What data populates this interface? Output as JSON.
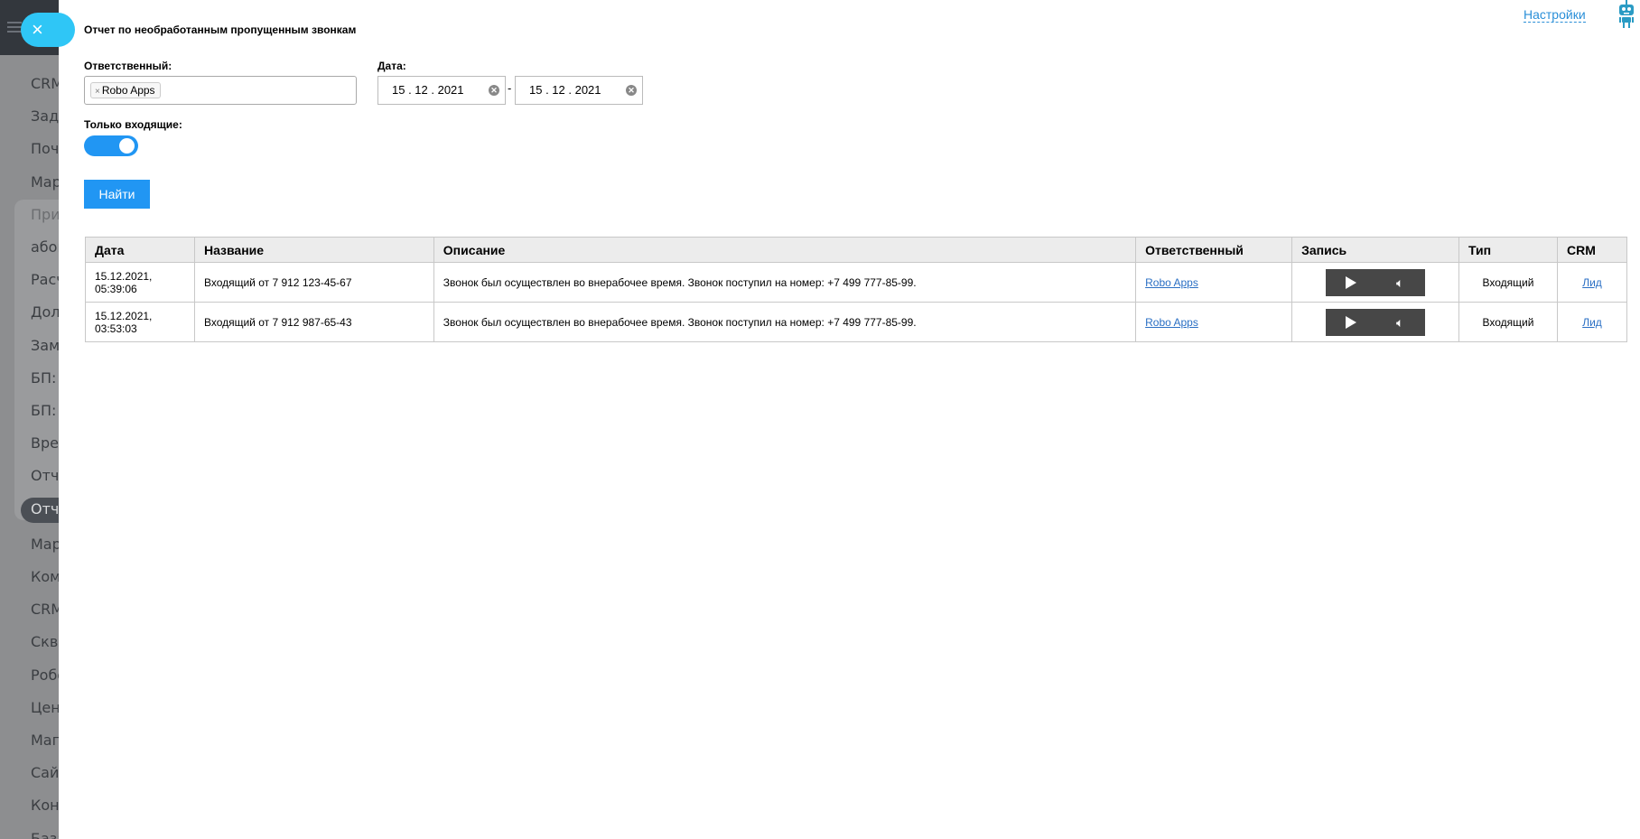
{
  "sidebar": {
    "close_label": "×",
    "items": [
      "CRM",
      "Зада",
      "Почт",
      "Мар",
      "При",
      "абон",
      "Расч",
      "Долг",
      "Заме",
      "БП: С",
      "БП: З",
      "Врем",
      "Отче",
      "Отче",
      "Мар",
      "Ком",
      "CRM",
      "Скво",
      "Робо",
      "Цент",
      "Мага",
      "Сайт",
      "Конт",
      "База"
    ]
  },
  "header": {
    "title": "Отчет по необработанным пропущенным звонкам",
    "settings_label": "Настройки"
  },
  "filters": {
    "responsible_label": "Ответственный:",
    "responsible_chip": "Robo Apps",
    "chip_remove": "×",
    "date_label": "Дата:",
    "date_from": "15 . 12 . 2021",
    "date_to": "15 . 12 . 2021",
    "date_separator": "-",
    "incoming_only_label": "Только входящие:",
    "incoming_only": true,
    "find_label": "Найти"
  },
  "table": {
    "headers": [
      "Дата",
      "Название",
      "Описание",
      "Ответственный",
      "Запись",
      "Тип",
      "CRM"
    ],
    "rows": [
      {
        "date": "15.12.2021,",
        "time": "05:39:06",
        "name": "Входящий от 7 912 123-45-67",
        "description": "Звонок был осуществлен во внерабочее время. Звонок поступил на номер: +7 499 777-85-99.",
        "responsible": "Robo Apps",
        "type": "Входящий",
        "crm": "Лид"
      },
      {
        "date": "15.12.2021,",
        "time": "03:53:03",
        "name": "Входящий от 7 912 987-65-43",
        "description": "Звонок был осуществлен во внерабочее время. Звонок поступил на номер: +7 499 777-85-99.",
        "responsible": "Robo Apps",
        "type": "Входящий",
        "crm": "Лид"
      }
    ]
  },
  "colors": {
    "accent": "#2196f3",
    "link": "#2a6fc4",
    "sidebar": "#8d8e90",
    "close": "#2fc6f6"
  }
}
